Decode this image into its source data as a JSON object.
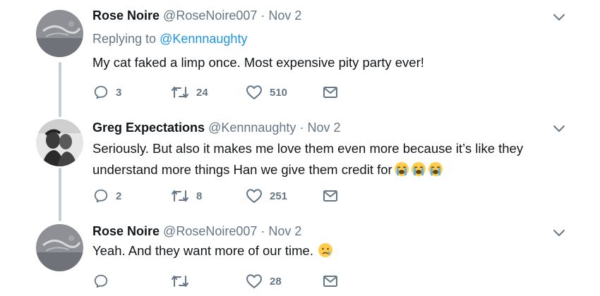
{
  "tweets": [
    {
      "name": "Rose Noire",
      "handle": "@RoseNoire007",
      "separator": "·",
      "date": "Nov 2",
      "replying_prefix": "Replying to",
      "replying_to": "@Kennnaughty",
      "text": "My cat faked a limp once. Most expensive pity party ever!",
      "replies": "3",
      "retweets": "24",
      "likes": "510",
      "avatar": "rose-noire-avatar"
    },
    {
      "name": "Greg Expectations",
      "handle": "@Kennnaughty",
      "separator": "·",
      "date": "Nov 2",
      "text_line1": "Seriously. But also it makes me love them even more because it’s like they",
      "text_line2": "understand more things Han we give them credit for",
      "emojis": [
        "loudly-crying-face",
        "loudly-crying-face",
        "loudly-crying-face"
      ],
      "replies": "2",
      "retweets": "8",
      "likes": "251",
      "avatar": "greg-expectations-avatar"
    },
    {
      "name": "Rose Noire",
      "handle": "@RoseNoire007",
      "separator": "·",
      "date": "Nov 2",
      "text": "Yeah. And they want more of our time.",
      "emojis": [
        "sad-relieved-face"
      ],
      "replies": "",
      "retweets": "",
      "likes": "28",
      "avatar": "rose-noire-avatar"
    }
  ],
  "icons": {
    "reply": "reply-icon",
    "retweet": "retweet-icon",
    "like": "heart-icon",
    "dm": "envelope-icon",
    "more": "chevron-down-icon"
  },
  "colors": {
    "text": "#14171a",
    "secondary": "#657786",
    "link": "#1b95e0",
    "thread_line": "#c4cfd6",
    "emoji": "#ffcc4d",
    "tears": "#5dadec"
  }
}
